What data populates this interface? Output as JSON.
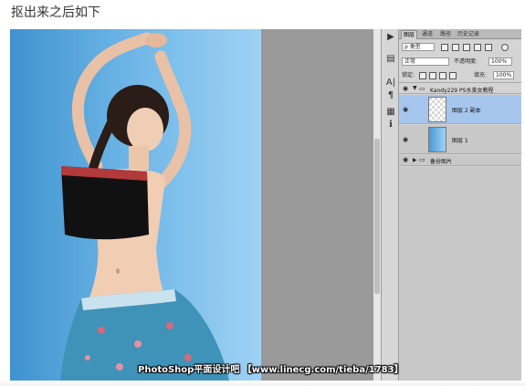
{
  "caption": "抠出来之后如下",
  "layers_panel": {
    "tabs": [
      "图层",
      "通道",
      "路径",
      "历史记录"
    ],
    "filter_kind": "ρ 类型",
    "blend_mode": "正常",
    "opacity_label": "不透明度:",
    "opacity_value": "100%",
    "lock_label": "锁定:",
    "fill_label": "填充:",
    "fill_value": "100%",
    "group_name": "Kandy229 PS水美女教程",
    "layers": [
      {
        "name": "图层 2 副本",
        "selected": true
      },
      {
        "name": "图层 1",
        "selected": false
      }
    ],
    "backup_group": "备份图片"
  },
  "watermark": "PhotoShop平面设计吧 【www.linecg.com/tieba/1783】",
  "colors": {
    "selected_layer": "#a7c6ee",
    "panel_bg": "#d4d4d4",
    "canvas_blue": "#5aa9e0"
  }
}
